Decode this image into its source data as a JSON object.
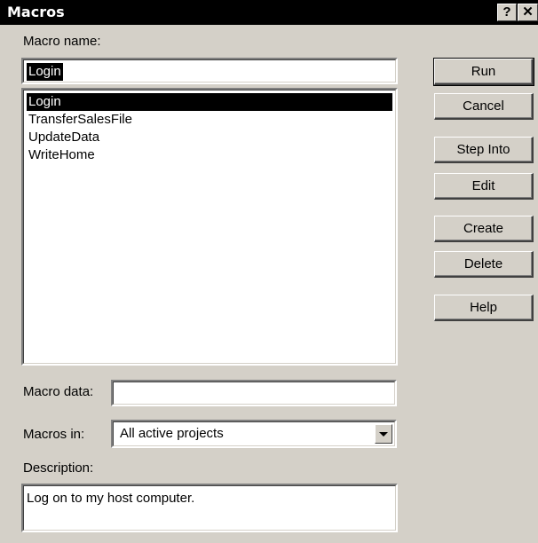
{
  "window": {
    "title": "Macros",
    "help_button": "?",
    "close_button": "✕"
  },
  "macro_name": {
    "label": "Macro name:",
    "value": "Login"
  },
  "macro_list": {
    "items": [
      "Login",
      "TransferSalesFile",
      "UpdateData",
      "WriteHome"
    ],
    "selected": "Login"
  },
  "macro_data": {
    "label": "Macro data:",
    "value": ""
  },
  "macros_in": {
    "label": "Macros in:",
    "value": "All active projects"
  },
  "description": {
    "label": "Description:",
    "value": "Log on to my host computer."
  },
  "buttons": {
    "run": "Run",
    "cancel": "Cancel",
    "step_into": "Step Into",
    "edit": "Edit",
    "create": "Create",
    "delete": "Delete",
    "help": "Help"
  }
}
